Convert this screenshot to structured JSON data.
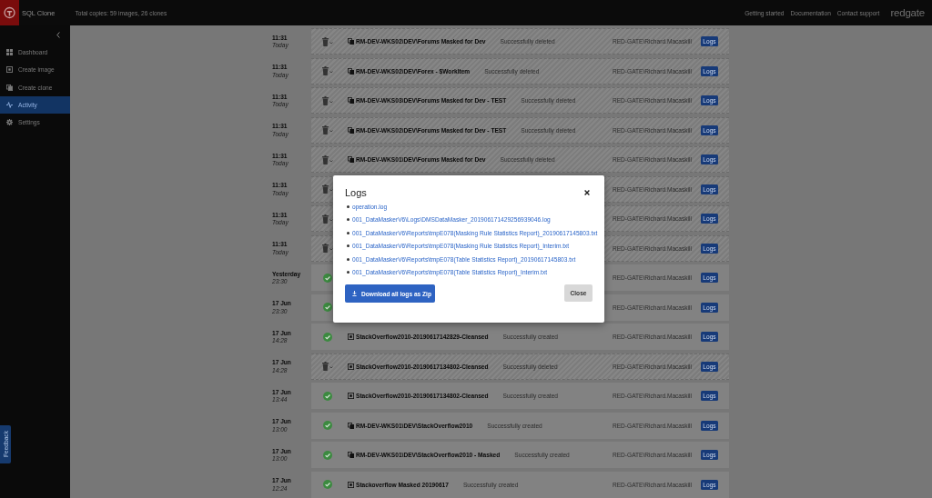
{
  "header": {
    "product": "SQL Clone",
    "summary": "Total copies: 59 images, 26 clones",
    "links": [
      "Getting started",
      "Documentation",
      "Contact support"
    ],
    "brand": "redgate"
  },
  "sidebar": {
    "items": [
      {
        "label": "Dashboard",
        "selected": false
      },
      {
        "label": "Create image",
        "selected": false
      },
      {
        "label": "Create clone",
        "selected": false
      },
      {
        "label": "Activity",
        "selected": true
      },
      {
        "label": "Settings",
        "selected": false
      }
    ],
    "feedback": "Feedback"
  },
  "activity": [
    {
      "when": "11:31",
      "when_detail": "Today",
      "deleted": true,
      "kind": "clone",
      "name": "RM-DEV-WKS02\\DEV\\Forums Masked for Dev",
      "message": "Successfully deleted",
      "user": "RED-GATE\\Richard.Macaskill",
      "action": "Logs"
    },
    {
      "when": "11:31",
      "when_detail": "Today",
      "deleted": true,
      "kind": "clone",
      "name": "RM-DEV-WKS02\\DEV\\Forex - $WorkItem",
      "message": "Successfully deleted",
      "user": "RED-GATE\\Richard.Macaskill",
      "action": "Logs"
    },
    {
      "when": "11:31",
      "when_detail": "Today",
      "deleted": true,
      "kind": "clone",
      "name": "RM-DEV-WKS03\\DEV\\Forums Masked for Dev - TEST",
      "message": "Successfully deleted",
      "user": "RED-GATE\\Richard.Macaskill",
      "action": "Logs"
    },
    {
      "when": "11:31",
      "when_detail": "Today",
      "deleted": true,
      "kind": "clone",
      "name": "RM-DEV-WKS02\\DEV\\Forums Masked for Dev - TEST",
      "message": "Successfully deleted",
      "user": "RED-GATE\\Richard.Macaskill",
      "action": "Logs"
    },
    {
      "when": "11:31",
      "when_detail": "Today",
      "deleted": true,
      "kind": "clone",
      "name": "RM-DEV-WKS01\\DEV\\Forums Masked for Dev",
      "message": "Successfully deleted",
      "user": "RED-GATE\\Richard.Macaskill",
      "action": "Logs"
    },
    {
      "when": "11:31",
      "when_detail": "Today",
      "deleted": true,
      "user": "RED-GATE\\Richard.Macaskill",
      "action": "Logs"
    },
    {
      "when": "11:31",
      "when_detail": "Today",
      "deleted": true,
      "user": "RED-GATE\\Richard.Macaskill",
      "action": "Logs"
    },
    {
      "when": "11:31",
      "when_detail": "Today",
      "deleted": true,
      "user": "RED-GATE\\Richard.Macaskill",
      "action": "Logs"
    },
    {
      "when": "Yesterday",
      "when_detail": "23:30",
      "deleted": false,
      "user": "RED-GATE\\Richard.Macaskill",
      "action": "Logs"
    },
    {
      "when": "17 Jun",
      "when_detail": "23:30",
      "deleted": false,
      "user": "RED-GATE\\Richard.Macaskill",
      "action": "Logs"
    },
    {
      "when": "17 Jun",
      "when_detail": "14:28",
      "deleted": false,
      "kind": "image",
      "name": "StackOverflow2010-20190617142829-Cleansed",
      "message": "Successfully created",
      "user": "RED-GATE\\Richard.Macaskill",
      "action": "Logs"
    },
    {
      "when": "17 Jun",
      "when_detail": "14:28",
      "deleted": true,
      "kind": "image",
      "name": "StackOverflow2010-20190617134802-Cleansed",
      "message": "Successfully deleted",
      "user": "RED-GATE\\Richard.Macaskill",
      "action": "Logs"
    },
    {
      "when": "17 Jun",
      "when_detail": "13:44",
      "deleted": false,
      "kind": "image",
      "name": "StackOverflow2010-20190617134802-Cleansed",
      "message": "Successfully created",
      "user": "RED-GATE\\Richard.Macaskill",
      "action": "Logs"
    },
    {
      "when": "17 Jun",
      "when_detail": "13:00",
      "deleted": false,
      "kind": "clone",
      "name": "RM-DEV-WKS01\\DEV\\StackOverflow2010",
      "message": "Successfully created",
      "user": "RED-GATE\\Richard.Macaskill",
      "action": "Logs"
    },
    {
      "when": "17 Jun",
      "when_detail": "13:00",
      "deleted": false,
      "kind": "clone",
      "name": "RM-DEV-WKS01\\DEV\\StackOverflow2010 - Masked",
      "message": "Successfully created",
      "user": "RED-GATE\\Richard.Macaskill",
      "action": "Logs"
    },
    {
      "when": "17 Jun",
      "when_detail": "12:24",
      "deleted": false,
      "kind": "image",
      "name": "Stackoverflow Masked 20190617",
      "message": "Successfully created",
      "user": "RED-GATE\\Richard.Macaskill",
      "action": "Logs"
    }
  ],
  "dialog": {
    "title": "Logs",
    "files": [
      "operation.log",
      "001_DataMaskerV6\\Logs\\DMSDataMasker_201906171429256939046.log",
      "001_DataMaskerV6\\Reports\\tmpE078(Masking Rule Statistics Report)_20190617145803.txt",
      "001_DataMaskerV6\\Reports\\tmpE078(Masking Rule Statistics Report)_Interim.txt",
      "001_DataMaskerV6\\Reports\\tmpE078(Table Statistics Report)_20190617145803.txt",
      "001_DataMaskerV6\\Reports\\tmpE078(Table Statistics Report)_Interim.txt"
    ],
    "download": "Download all logs as Zip",
    "close": "Close"
  }
}
